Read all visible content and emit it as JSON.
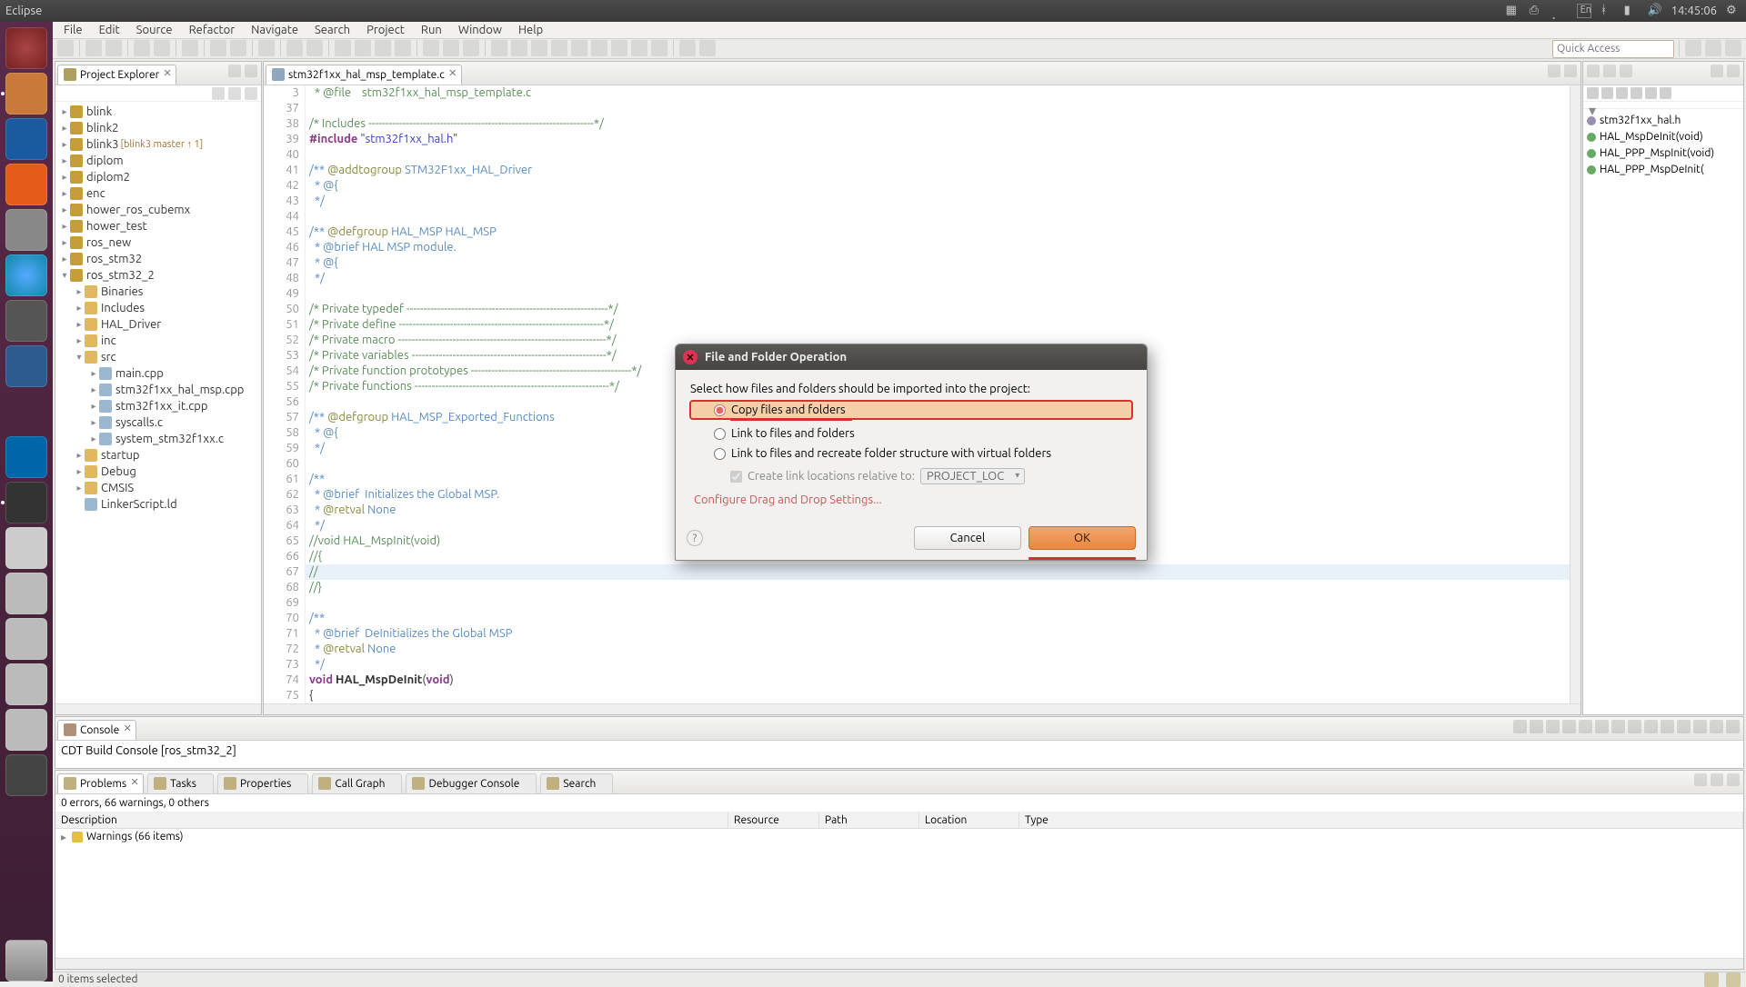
{
  "panel": {
    "app_title": "Eclipse",
    "time": "14:45:06",
    "lang": "En"
  },
  "menu": {
    "file": "File",
    "edit": "Edit",
    "source": "Source",
    "refactor": "Refactor",
    "navigate": "Navigate",
    "search": "Search",
    "project": "Project",
    "run": "Run",
    "window": "Window",
    "help": "Help"
  },
  "quick_access_placeholder": "Quick Access",
  "project_explorer": {
    "title": "Project Explorer",
    "items": [
      {
        "d": 0,
        "exp": "▸",
        "icon": "proj",
        "label": "blink"
      },
      {
        "d": 0,
        "exp": "▸",
        "icon": "proj",
        "label": "blink2"
      },
      {
        "d": 0,
        "exp": "▸",
        "icon": "proj",
        "label": "blink3",
        "deco": "[blink3 master ↑ 1]"
      },
      {
        "d": 0,
        "exp": "▸",
        "icon": "proj",
        "label": "diplom"
      },
      {
        "d": 0,
        "exp": "▸",
        "icon": "proj",
        "label": "diplom2"
      },
      {
        "d": 0,
        "exp": "▸",
        "icon": "proj",
        "label": "enc"
      },
      {
        "d": 0,
        "exp": "▸",
        "icon": "proj",
        "label": "hower_ros_cubemx"
      },
      {
        "d": 0,
        "exp": "▸",
        "icon": "proj",
        "label": "hower_test"
      },
      {
        "d": 0,
        "exp": "▸",
        "icon": "proj",
        "label": "ros_new"
      },
      {
        "d": 0,
        "exp": "▸",
        "icon": "proj",
        "label": "ros_stm32"
      },
      {
        "d": 0,
        "exp": "▾",
        "icon": "proj",
        "label": "ros_stm32_2"
      },
      {
        "d": 1,
        "exp": "▸",
        "icon": "folder",
        "label": "Binaries"
      },
      {
        "d": 1,
        "exp": "▸",
        "icon": "folder",
        "label": "Includes"
      },
      {
        "d": 1,
        "exp": "▸",
        "icon": "folder",
        "label": "HAL_Driver"
      },
      {
        "d": 1,
        "exp": "▸",
        "icon": "folder",
        "label": "inc"
      },
      {
        "d": 1,
        "exp": "▾",
        "icon": "folder",
        "label": "src"
      },
      {
        "d": 2,
        "exp": "▸",
        "icon": "file",
        "label": "main.cpp"
      },
      {
        "d": 2,
        "exp": "▸",
        "icon": "file",
        "label": "stm32f1xx_hal_msp.cpp"
      },
      {
        "d": 2,
        "exp": "▸",
        "icon": "file",
        "label": "stm32f1xx_it.cpp"
      },
      {
        "d": 2,
        "exp": "▸",
        "icon": "file",
        "label": "syscalls.c"
      },
      {
        "d": 2,
        "exp": "▸",
        "icon": "file",
        "label": "system_stm32f1xx.c"
      },
      {
        "d": 1,
        "exp": "▸",
        "icon": "folder",
        "label": "startup"
      },
      {
        "d": 1,
        "exp": "▸",
        "icon": "folder",
        "label": "Debug"
      },
      {
        "d": 1,
        "exp": "▸",
        "icon": "folder",
        "label": "CMSIS"
      },
      {
        "d": 1,
        "exp": " ",
        "icon": "file",
        "label": "LinkerScript.ld"
      }
    ]
  },
  "editor": {
    "tab_label": "stm32f1xx_hal_msp_template.c",
    "first_line_no": 3,
    "lines": [
      {
        "n": "3",
        "cls": "c-comment",
        "t": "  * @file    stm32f1xx_hal_msp_template.c"
      },
      {
        "n": "37",
        "cls": "",
        "t": ""
      },
      {
        "n": "38",
        "cls": "c-comment",
        "t": "/* Includes ------------------------------------------------------------------*/"
      },
      {
        "n": "39",
        "cls": "",
        "t": "#include \"stm32f1xx_hal.h\"",
        "html": "<span class='c-keyword'>#include</span> <span class='c-string'>\"stm32f1xx_hal.h\"</span>"
      },
      {
        "n": "40",
        "cls": "",
        "t": ""
      },
      {
        "n": "41",
        "cls": "c-doc",
        "t": "/** @addtogroup STM32F1xx_HAL_Driver",
        "html": "<span class='c-doc'>/** </span><span class='c-anno'>@addtogroup</span><span class='c-doc'> STM32F1xx_HAL_Driver</span>"
      },
      {
        "n": "42",
        "cls": "c-doc",
        "t": "  * @{"
      },
      {
        "n": "43",
        "cls": "c-doc",
        "t": "  */"
      },
      {
        "n": "44",
        "cls": "",
        "t": ""
      },
      {
        "n": "45",
        "cls": "c-doc",
        "t": "/** @defgroup HAL_MSP HAL_MSP",
        "html": "<span class='c-doc'>/** </span><span class='c-anno'>@defgroup</span><span class='c-doc'> HAL_MSP HAL_MSP</span>"
      },
      {
        "n": "46",
        "cls": "c-doc",
        "t": "  * @brief HAL MSP module."
      },
      {
        "n": "47",
        "cls": "c-doc",
        "t": "  * @{"
      },
      {
        "n": "48",
        "cls": "c-doc",
        "t": "  */"
      },
      {
        "n": "49",
        "cls": "",
        "t": ""
      },
      {
        "n": "50",
        "cls": "c-comment",
        "t": "/* Private typedef -----------------------------------------------------------*/"
      },
      {
        "n": "51",
        "cls": "c-comment",
        "t": "/* Private define ------------------------------------------------------------*/"
      },
      {
        "n": "52",
        "cls": "c-comment",
        "t": "/* Private macro -------------------------------------------------------------*/"
      },
      {
        "n": "53",
        "cls": "c-comment",
        "t": "/* Private variables ---------------------------------------------------------*/"
      },
      {
        "n": "54",
        "cls": "c-comment",
        "t": "/* Private function prototypes -----------------------------------------------*/"
      },
      {
        "n": "55",
        "cls": "c-comment",
        "t": "/* Private functions ---------------------------------------------------------*/"
      },
      {
        "n": "56",
        "cls": "",
        "t": ""
      },
      {
        "n": "57",
        "cls": "c-doc",
        "t": "/** @defgroup HAL_MSP_Exported_Functions",
        "html": "<span class='c-doc'>/** </span><span class='c-anno'>@defgroup</span><span class='c-doc'> HAL_MSP_Exported_Functions</span>"
      },
      {
        "n": "58",
        "cls": "c-doc",
        "t": "  * @{"
      },
      {
        "n": "59",
        "cls": "c-doc",
        "t": "  */"
      },
      {
        "n": "60",
        "cls": "",
        "t": ""
      },
      {
        "n": "61",
        "cls": "c-doc",
        "t": "/**"
      },
      {
        "n": "62",
        "cls": "c-doc",
        "t": "  * @brief  Initializes the Global MSP."
      },
      {
        "n": "63",
        "cls": "c-doc",
        "t": "  * @retval None",
        "html": "<span class='c-doc'>  * </span><span class='c-anno'>@retval</span><span class='c-doc'> None</span>"
      },
      {
        "n": "64",
        "cls": "c-doc",
        "t": "  */"
      },
      {
        "n": "65",
        "cls": "c-comment",
        "t": "//void HAL_MspInit(void)"
      },
      {
        "n": "66",
        "cls": "c-comment",
        "t": "//{"
      },
      {
        "n": "67",
        "cls": "c-comment",
        "t": "//"
      },
      {
        "n": "68",
        "cls": "c-comment",
        "t": "//}"
      },
      {
        "n": "69",
        "cls": "",
        "t": ""
      },
      {
        "n": "70",
        "cls": "c-doc",
        "t": "/**"
      },
      {
        "n": "71",
        "cls": "c-doc",
        "t": "  * @brief  DeInitializes the Global MSP"
      },
      {
        "n": "72",
        "cls": "c-doc",
        "t": "  * @retval None",
        "html": "<span class='c-doc'>  * </span><span class='c-anno'>@retval</span><span class='c-doc'> None</span>"
      },
      {
        "n": "73",
        "cls": "c-doc",
        "t": "  */"
      },
      {
        "n": "74",
        "cls": "",
        "t": "void HAL_MspDeInit(void)",
        "html": "<span class='c-keyword'>void</span> <b>HAL_MspDeInit</b>(<span class='c-keyword'>void</span>)"
      },
      {
        "n": "75",
        "cls": "",
        "t": "{"
      }
    ],
    "highlight_index": 31
  },
  "outline": {
    "items": [
      {
        "type": "h",
        "label": "stm32f1xx_hal.h"
      },
      {
        "type": "f",
        "label": "HAL_MspDeInit(void)"
      },
      {
        "type": "f",
        "label": "HAL_PPP_MspInit(void)"
      },
      {
        "type": "f",
        "label": "HAL_PPP_MspDeInit("
      }
    ]
  },
  "console": {
    "title": "Console",
    "body": "CDT Build Console [ros_stm32_2]"
  },
  "problems": {
    "tabs": [
      "Problems",
      "Tasks",
      "Properties",
      "Call Graph",
      "Debugger Console",
      "Search"
    ],
    "summary": "0 errors, 66 warnings, 0 others",
    "cols": [
      "Description",
      "Resource",
      "Path",
      "Location",
      "Type"
    ],
    "row": "Warnings (66 items)"
  },
  "status": {
    "left": "0 items selected"
  },
  "dialog": {
    "title": "File and Folder Operation",
    "msg": "Select how files and folders should be imported into the project:",
    "opt1": "Copy files and folders",
    "opt2": "Link to files and folders",
    "opt3": "Link to files and recreate folder structure with virtual folders",
    "chk": "Create link locations relative to:",
    "combo": "PROJECT_LOC",
    "link": "Configure Drag and Drop Settings...",
    "cancel": "Cancel",
    "ok": "OK"
  }
}
